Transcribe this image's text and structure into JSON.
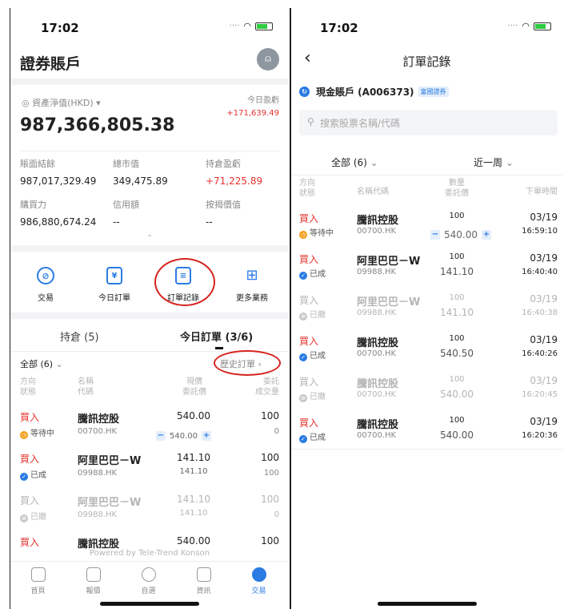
{
  "left": {
    "status_time": "17:02",
    "title": "證券賬戶",
    "net_value_label": "資產淨值(HKD)",
    "net_value": "987,366,805.38",
    "today_pl_label": "今日盈虧",
    "today_pl": "+171,639.49",
    "stats": [
      {
        "label": "賬面結餘",
        "value": "987,017,329.49",
        "color": "normal"
      },
      {
        "label": "總市值",
        "value": "349,475.89",
        "color": "normal"
      },
      {
        "label": "持倉盈虧",
        "value": "+71,225.89",
        "color": "red"
      },
      {
        "label": "購買力",
        "value": "986,880,674.24",
        "color": "normal"
      },
      {
        "label": "信用額",
        "value": "--",
        "color": "normal"
      },
      {
        "label": "按揭價值",
        "value": "--",
        "color": "normal"
      }
    ],
    "menu": [
      {
        "label": "交易",
        "icon": "trade-icon"
      },
      {
        "label": "今日訂單",
        "icon": "calendar-yen-icon"
      },
      {
        "label": "訂單記錄",
        "icon": "order-record-icon"
      },
      {
        "label": "更多業務",
        "icon": "grid-icon"
      }
    ],
    "tabs": {
      "holdings": "持倉 (5)",
      "today_orders": "今日訂單 (3/6)"
    },
    "filter": "全部 (6)",
    "history": "歷史訂單",
    "headers": {
      "h1a": "方向",
      "h1b": "狀態",
      "h2a": "名稱",
      "h2b": "代碼",
      "h3a": "現價",
      "h3b": "委託價",
      "h4a": "委託",
      "h4b": "成交量"
    },
    "rows": [
      {
        "dir": "買入",
        "status": "等待中",
        "state": "pending",
        "name": "騰訊控股",
        "code": "00700.HK",
        "price": "540.00",
        "order_price": "540.00",
        "qty": "100",
        "filled": "0"
      },
      {
        "dir": "買入",
        "status": "已成",
        "state": "done",
        "name": "阿里巴巴－W",
        "code": "09988.HK",
        "price": "141.10",
        "order_price": "141.10",
        "qty": "100",
        "filled": "100"
      },
      {
        "dir": "買入",
        "status": "已撤",
        "state": "cancel",
        "name": "阿里巴巴－W",
        "code": "09988.HK",
        "price": "141.10",
        "order_price": "141.10",
        "qty": "100",
        "filled": "0"
      },
      {
        "dir": "買入",
        "status": "",
        "state": "partial",
        "name": "騰訊控股",
        "code": "",
        "price": "540.00",
        "order_price": "",
        "qty": "100",
        "filled": ""
      }
    ],
    "powered_by": "Powered by Tele-Trend Konson",
    "bottom_tabs": [
      "首頁",
      "報價",
      "自選",
      "資訊",
      "交易"
    ]
  },
  "right": {
    "status_time": "17:02",
    "title": "訂單記錄",
    "account": "現金賬戶 (A006373)",
    "account_badge": "富國證券",
    "search_placeholder": "搜索股票名稱/代碼",
    "filter_all": "全部 (6)",
    "filter_period": "近一周",
    "headers": {
      "h1a": "方向",
      "h1b": "狀態",
      "h2": "名稱代碼",
      "h3a": "數量",
      "h3b": "委託價",
      "h4": "下單時間"
    },
    "rows": [
      {
        "dir": "買入",
        "status": "等待中",
        "state": "pending",
        "name": "騰訊控股",
        "code": "00700.HK",
        "qty": "100",
        "price": "540.00",
        "date": "03/19",
        "time": "16:59:10"
      },
      {
        "dir": "買入",
        "status": "已成",
        "state": "done",
        "name": "阿里巴巴－W",
        "code": "09988.HK",
        "qty": "100",
        "price": "141.10",
        "date": "03/19",
        "time": "16:40:40"
      },
      {
        "dir": "買入",
        "status": "已撤",
        "state": "cancel",
        "name": "阿里巴巴－W",
        "code": "09988.HK",
        "qty": "100",
        "price": "141.10",
        "date": "03/19",
        "time": "16:40:38"
      },
      {
        "dir": "買入",
        "status": "已成",
        "state": "done",
        "name": "騰訊控股",
        "code": "00700.HK",
        "qty": "100",
        "price": "540.50",
        "date": "03/19",
        "time": "16:40:26"
      },
      {
        "dir": "買入",
        "status": "已撤",
        "state": "cancel",
        "name": "騰訊控股",
        "code": "00700.HK",
        "qty": "100",
        "price": "540.00",
        "date": "03/19",
        "time": "16:20:45"
      },
      {
        "dir": "買入",
        "status": "已成",
        "state": "done",
        "name": "騰訊控股",
        "code": "00700.HK",
        "qty": "100",
        "price": "540.00",
        "date": "03/19",
        "time": "16:20:36"
      }
    ]
  },
  "colors": {
    "accent": "#2a7be4",
    "up": "#e5322d",
    "annotation": "#d6231e"
  }
}
